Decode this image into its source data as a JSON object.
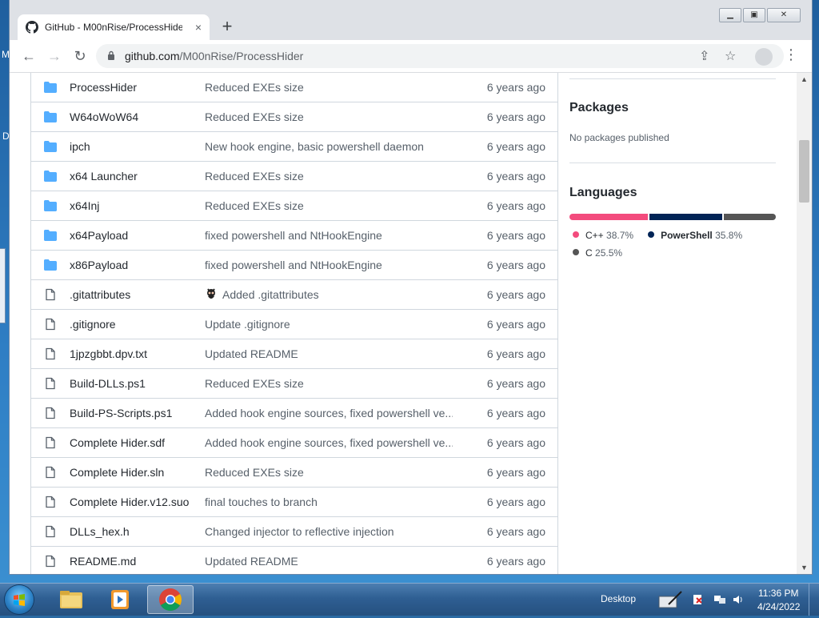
{
  "browser": {
    "tab_title": "GitHub - M00nRise/ProcessHider",
    "tab_close": "×",
    "new_tab": "+",
    "url_host": "github.com",
    "url_path": "/M00nRise/ProcessHider"
  },
  "desktop": {
    "frag_m": "M",
    "frag_d": "D"
  },
  "files": [
    {
      "type": "folder",
      "name": "ProcessHider",
      "message": "Reduced EXEs size",
      "age": "6 years ago"
    },
    {
      "type": "folder",
      "name": "W64oWoW64",
      "message": "Reduced EXEs size",
      "age": "6 years ago"
    },
    {
      "type": "folder",
      "name": "ipch",
      "message": "New hook engine, basic powershell daemon",
      "age": "6 years ago"
    },
    {
      "type": "folder",
      "name": "x64 Launcher",
      "message": "Reduced EXEs size",
      "age": "6 years ago"
    },
    {
      "type": "folder",
      "name": "x64Inj",
      "message": "Reduced EXEs size",
      "age": "6 years ago"
    },
    {
      "type": "folder",
      "name": "x64Payload",
      "message": "fixed powershell and NtHookEngine",
      "age": "6 years ago"
    },
    {
      "type": "folder",
      "name": "x86Payload",
      "message": "fixed powershell and NtHookEngine",
      "age": "6 years ago"
    },
    {
      "type": "file",
      "name": ".gitattributes",
      "message": "Added .gitattributes",
      "age": "6 years ago",
      "octocat": true
    },
    {
      "type": "file",
      "name": ".gitignore",
      "message": "Update .gitignore",
      "age": "6 years ago"
    },
    {
      "type": "file",
      "name": "1jpzgbbt.dpv.txt",
      "message": "Updated README",
      "age": "6 years ago"
    },
    {
      "type": "file",
      "name": "Build-DLLs.ps1",
      "message": "Reduced EXEs size",
      "age": "6 years ago"
    },
    {
      "type": "file",
      "name": "Build-PS-Scripts.ps1",
      "message": "Added hook engine sources, fixed powershell ve...",
      "age": "6 years ago"
    },
    {
      "type": "file",
      "name": "Complete Hider.sdf",
      "message": "Added hook engine sources, fixed powershell ve...",
      "age": "6 years ago"
    },
    {
      "type": "file",
      "name": "Complete Hider.sln",
      "message": "Reduced EXEs size",
      "age": "6 years ago"
    },
    {
      "type": "file",
      "name": "Complete Hider.v12.suo",
      "message": "final touches to branch",
      "age": "6 years ago"
    },
    {
      "type": "file",
      "name": "DLLs_hex.h",
      "message": "Changed injector to reflective injection",
      "age": "6 years ago"
    },
    {
      "type": "file",
      "name": "README.md",
      "message": "Updated README",
      "age": "6 years ago"
    }
  ],
  "sidebar": {
    "packages_title": "Packages",
    "packages_note": "No packages published",
    "languages_title": "Languages",
    "languages": [
      {
        "name": "C++",
        "percent": "38.7%",
        "value": 38.7,
        "color": "#f34b7d"
      },
      {
        "name": "PowerShell",
        "percent": "35.8%",
        "value": 35.8,
        "color": "#012456"
      },
      {
        "name": "C",
        "percent": "25.5%",
        "value": 25.5,
        "color": "#555555"
      }
    ]
  },
  "taskbar": {
    "desktop_label": "Desktop",
    "time": "11:36 PM",
    "date": "4/24/2022"
  },
  "colors": {
    "folder": "#54aeff",
    "file_icon": "#57606a"
  }
}
